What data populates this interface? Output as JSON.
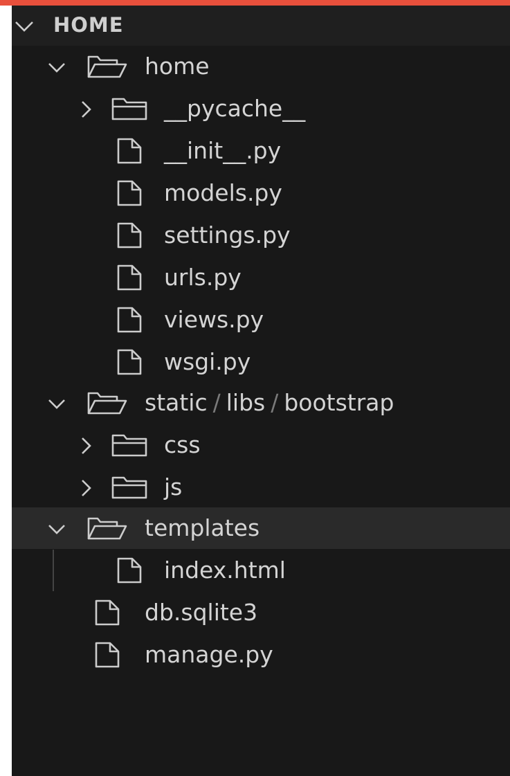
{
  "colors": {
    "accent": "#e8503c",
    "panel": "#181818",
    "header": "#1f1f1f",
    "active_row": "#2a2a2a",
    "text": "#d4d4d4",
    "icon": "#cccccc"
  },
  "explorer": {
    "section_title": "HOME",
    "rows": [
      {
        "label": "home",
        "type": "folder-open",
        "icon": "folder-open-icon",
        "chevron": "chevron-down-icon"
      },
      {
        "label": "__pycache__",
        "type": "folder",
        "icon": "folder-icon",
        "chevron": "chevron-right-icon"
      },
      {
        "label": "__init__.py",
        "type": "file",
        "icon": "file-icon"
      },
      {
        "label": "models.py",
        "type": "file",
        "icon": "file-icon"
      },
      {
        "label": "settings.py",
        "type": "file",
        "icon": "file-icon"
      },
      {
        "label": "urls.py",
        "type": "file",
        "icon": "file-icon"
      },
      {
        "label": "views.py",
        "type": "file",
        "icon": "file-icon"
      },
      {
        "label": "wsgi.py",
        "type": "file",
        "icon": "file-icon"
      },
      {
        "path_parts": [
          "static",
          "libs",
          "bootstrap"
        ],
        "path_separator": "/",
        "type": "folder-open",
        "icon": "folder-open-icon",
        "chevron": "chevron-down-icon"
      },
      {
        "label": "css",
        "type": "folder",
        "icon": "folder-icon",
        "chevron": "chevron-right-icon"
      },
      {
        "label": "js",
        "type": "folder",
        "icon": "folder-icon",
        "chevron": "chevron-right-icon"
      },
      {
        "label": "templates",
        "type": "folder-open",
        "icon": "folder-open-icon",
        "chevron": "chevron-down-icon",
        "active": true
      },
      {
        "label": "index.html",
        "type": "file",
        "icon": "file-icon"
      },
      {
        "label": "db.sqlite3",
        "type": "file",
        "icon": "file-icon"
      },
      {
        "label": "manage.py",
        "type": "file",
        "icon": "file-icon"
      }
    ]
  }
}
